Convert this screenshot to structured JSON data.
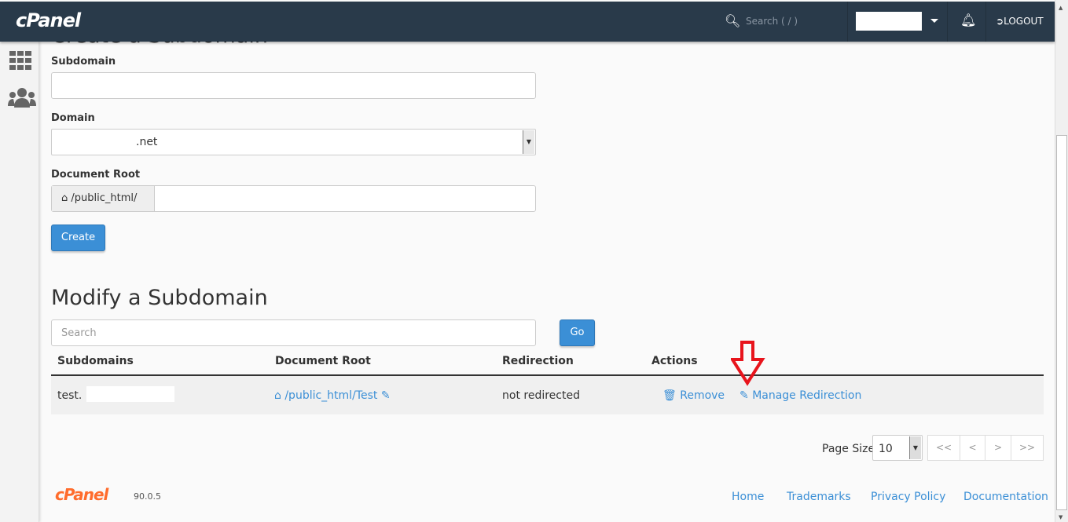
{
  "header": {
    "logo": "cPanel",
    "search_placeholder": "Search ( / )",
    "logout_label": "LOGOUT"
  },
  "create": {
    "title": "Create a Subdomain",
    "subdomain_label": "Subdomain",
    "subdomain_value": "",
    "domain_label": "Domain",
    "domain_value": ".net",
    "docroot_label": "Document Root",
    "docroot_prefix": "/public_html/",
    "docroot_value": "",
    "create_button": "Create"
  },
  "modify": {
    "title": "Modify a Subdomain",
    "search_placeholder": "Search",
    "go_button": "Go",
    "columns": [
      "Subdomains",
      "Document Root",
      "Redirection",
      "Actions"
    ],
    "rows": [
      {
        "subdomain": "test.",
        "docroot": "/public_html/Test",
        "redirection": "not redirected",
        "remove": "Remove",
        "manage": "Manage Redirection"
      }
    ],
    "page_size_label": "Page Size",
    "page_size": "10",
    "pager": [
      "<<",
      "<",
      ">",
      ">>"
    ]
  },
  "footer": {
    "logo": "cPanel",
    "version": "90.0.5",
    "links": [
      "Home",
      "Trademarks",
      "Privacy Policy",
      "Documentation"
    ]
  },
  "colors": {
    "header": "#293a4a",
    "accent": "#3b8fd6",
    "annotation_arrow": "#e8141c"
  }
}
